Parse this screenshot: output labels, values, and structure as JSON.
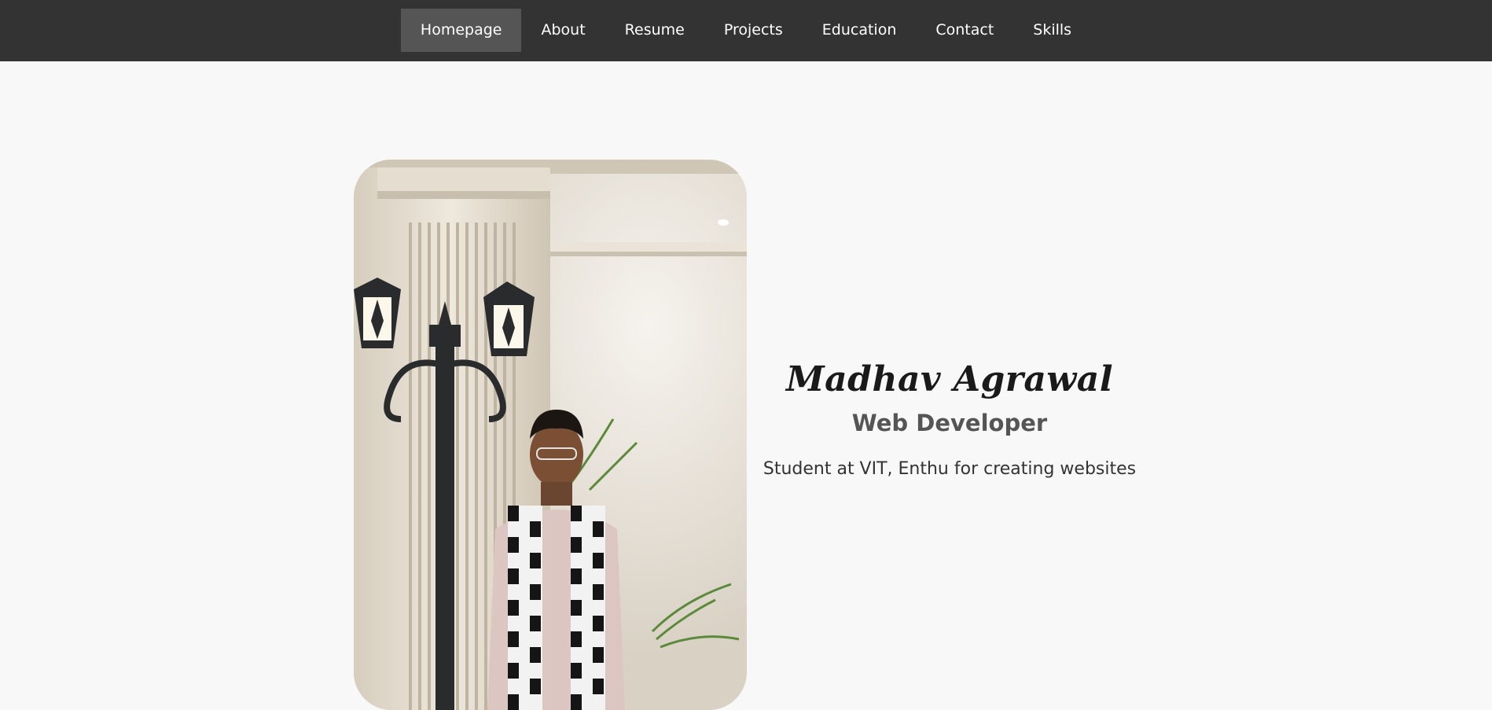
{
  "nav": {
    "items": [
      {
        "label": "Homepage",
        "active": true
      },
      {
        "label": "About"
      },
      {
        "label": "Resume"
      },
      {
        "label": "Projects"
      },
      {
        "label": "Education"
      },
      {
        "label": "Contact"
      },
      {
        "label": "Skills"
      }
    ]
  },
  "hero": {
    "name": "Madhav Agrawal",
    "role": "Web Developer",
    "description": "Student at VIT, Enthu for creating websites"
  },
  "colors": {
    "navbar_bg": "#333333",
    "nav_active_bg": "#555555",
    "page_bg": "#f8f8f8"
  }
}
